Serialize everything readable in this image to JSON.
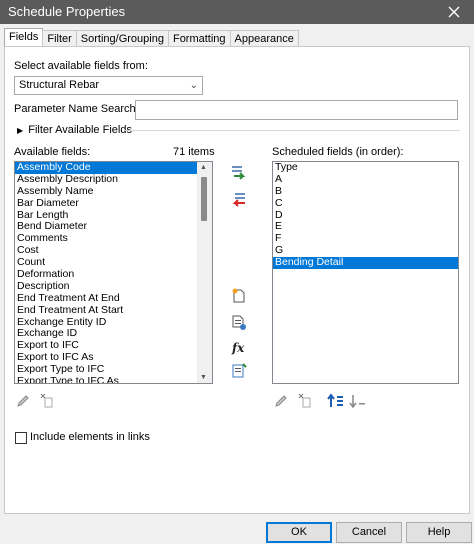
{
  "window": {
    "title": "Schedule Properties"
  },
  "tabs": [
    {
      "label": "Fields"
    },
    {
      "label": "Filter"
    },
    {
      "label": "Sorting/Grouping"
    },
    {
      "label": "Formatting"
    },
    {
      "label": "Appearance"
    }
  ],
  "fields": {
    "select_from_label": "Select available fields from:",
    "select_from_value": "Structural Rebar",
    "param_search_label": "Parameter Name Search:",
    "param_search_value": "",
    "filter_label": "Filter Available Fields",
    "available_label": "Available fields:",
    "available_count": "71 items",
    "available_items": [
      "Assembly Code",
      "Assembly Description",
      "Assembly Name",
      "Bar Diameter",
      "Bar Length",
      "Bend Diameter",
      "Comments",
      "Cost",
      "Count",
      "Deformation",
      "Description",
      "End Treatment At End",
      "End Treatment At Start",
      "Exchange Entity ID",
      "Exchange ID",
      "Export to IFC",
      "Export to IFC As",
      "Export Type to IFC",
      "Export Type to IFC As"
    ],
    "scheduled_label": "Scheduled fields (in order):",
    "scheduled_items": [
      "Type",
      "A",
      "B",
      "C",
      "D",
      "E",
      "F",
      "G",
      "Bending Detail"
    ],
    "include_links_label": "Include elements in links",
    "include_links_checked": false
  },
  "buttons": {
    "ok": "OK",
    "cancel": "Cancel",
    "help": "Help"
  },
  "colors": {
    "selection": "#0078d7",
    "titlebar": "#5b5b5b",
    "add_arrow": "#2e8b3e",
    "remove_arrow": "#d62828"
  }
}
